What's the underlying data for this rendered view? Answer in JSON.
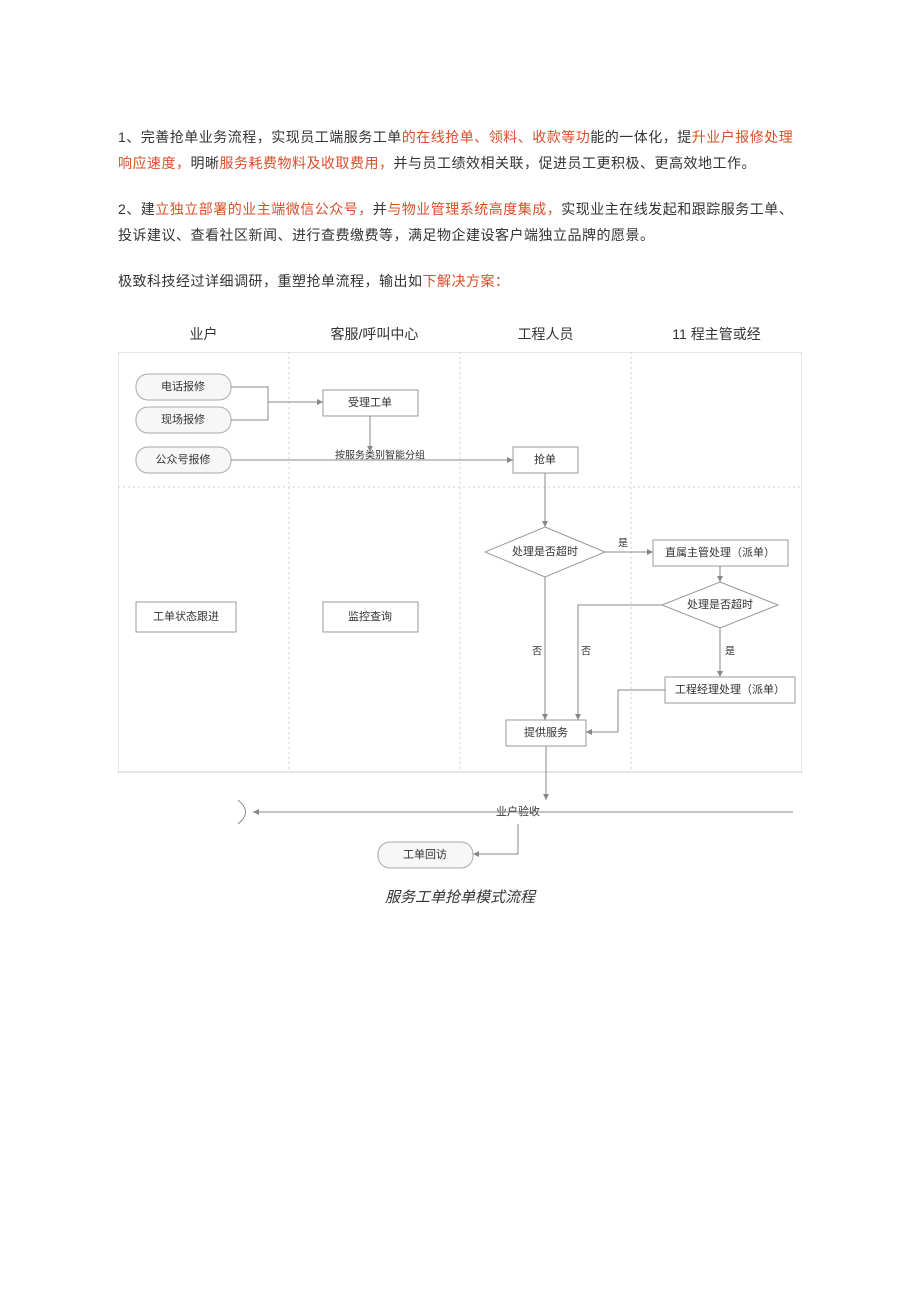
{
  "paragraphs": {
    "p1": {
      "num": "1",
      "t1": "、完善抢单业务流程，实现员工端服务工单",
      "h1": "的在线抢单、领料、收款等功",
      "t2": "能的一体化，提",
      "h2": "升业户报修处理响应速度，",
      "t3": "明晰",
      "h3": "服务耗费物料及收取费用，",
      "t4": "并与员工绩效相关联，促进员工更积极、更高效地工作。"
    },
    "p2": {
      "num": "2",
      "t1": "、建",
      "h1": "立独立部署的业主端微信公众号，",
      "t2": "并",
      "h2": "与物业管理系统高度集成，",
      "t3": "实现业主在线发起和跟踪服务工单、投诉建议、查看社区新闻、进行查费缴费等，满足物企建设客户端独立品牌的愿景。"
    },
    "p3": {
      "t1": "极致科技经过详细调研，重塑抢单流程，输出如",
      "h1": "下解决方案："
    }
  },
  "lanes": {
    "c1": "业户",
    "c2": "客服/呼叫中心",
    "c3": "工程人员",
    "c4": "11 程主管或经"
  },
  "nodes": {
    "n_phone": "电话报修",
    "n_site": "现场报修",
    "n_wechat": "公众号报修",
    "n_accept": "受理工单",
    "n_dispatch_label": "按服务类别智能分组",
    "n_grab": "抢单",
    "d1": "处理是否超时",
    "d1_yes": "是",
    "d1_no": "否",
    "n_super": "直属主管处理（派单）",
    "d2": "处理是否超时",
    "d2_yes": "是",
    "d2_no": "否",
    "n_mgr": "工程经理处理（派单）",
    "n_serve": "提供服务",
    "n_track": "工单状态跟进",
    "n_monitor": "监控查询",
    "n_recv": "业户验收",
    "n_return": "工单回访"
  },
  "caption": "服务工单抢单模式流程"
}
